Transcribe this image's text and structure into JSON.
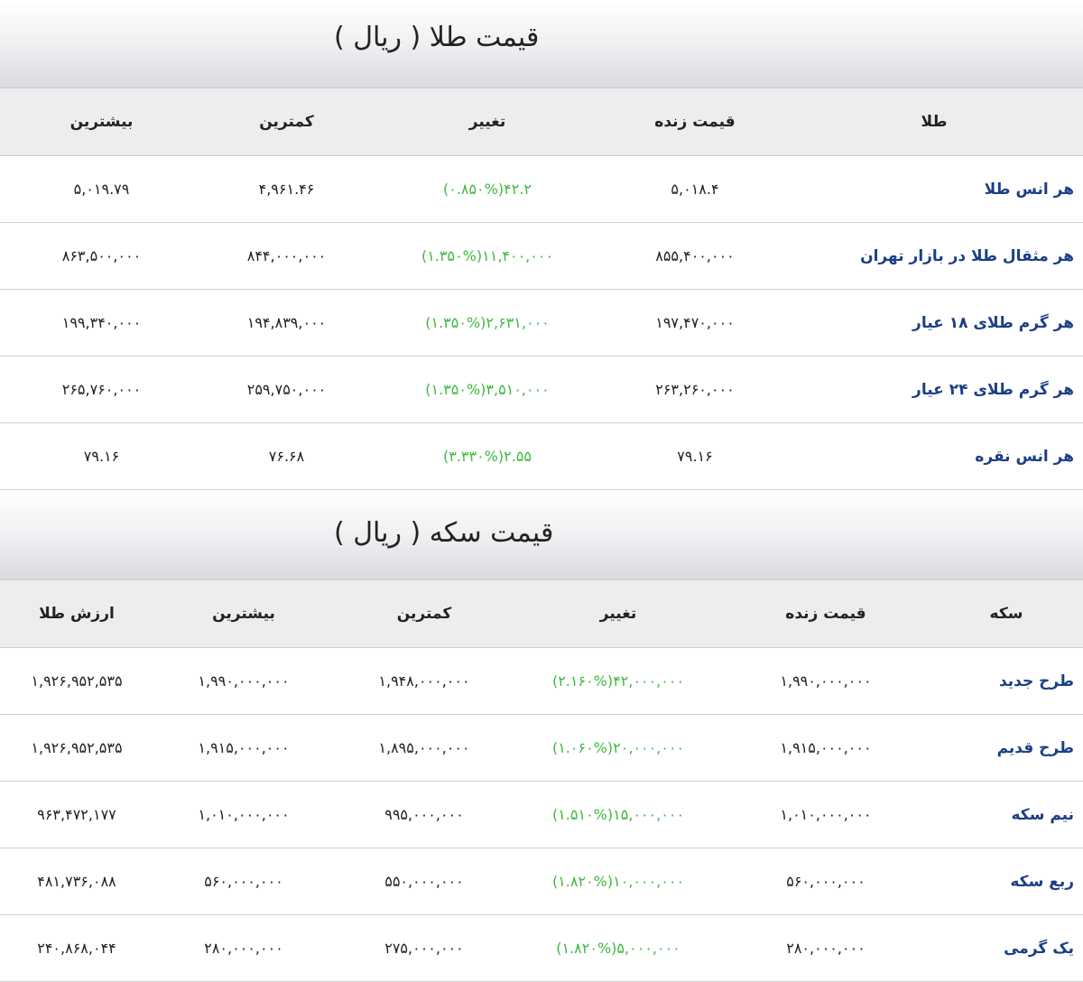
{
  "gold": {
    "title": "قیمت طلا ( ریال )",
    "headers": [
      "طلا",
      "قیمت زنده",
      "تغییر",
      "کمترین",
      "بیشترین"
    ],
    "rows": [
      {
        "name": "هر انس طلا",
        "live": "۵,۰۱۸.۴",
        "change": "۴۲.۲(۰.۸۵۰%)",
        "low": "۴,۹۶۱.۴۶",
        "high": "۵,۰۱۹.۷۹"
      },
      {
        "name": "هر مثقال طلا در بازار تهران",
        "live": "۸۵۵,۴۰۰,۰۰۰",
        "change": "۱۱,۴۰۰,۰۰۰(۱.۳۵۰%)",
        "low": "۸۴۴,۰۰۰,۰۰۰",
        "high": "۸۶۳,۵۰۰,۰۰۰"
      },
      {
        "name": "هر گرم طلای ۱۸ عیار",
        "live": "۱۹۷,۴۷۰,۰۰۰",
        "change": "۲,۶۳۱,۰۰۰(۱.۳۵۰%)",
        "low": "۱۹۴,۸۳۹,۰۰۰",
        "high": "۱۹۹,۳۴۰,۰۰۰"
      },
      {
        "name": "هر گرم طلای ۲۴ عیار",
        "live": "۲۶۳,۲۶۰,۰۰۰",
        "change": "۳,۵۱۰,۰۰۰(۱.۳۵۰%)",
        "low": "۲۵۹,۷۵۰,۰۰۰",
        "high": "۲۶۵,۷۶۰,۰۰۰"
      },
      {
        "name": "هر انس نقره",
        "live": "۷۹.۱۶",
        "change": "۲.۵۵(۳.۳۳۰%)",
        "low": "۷۶.۶۸",
        "high": "۷۹.۱۶"
      }
    ]
  },
  "coin": {
    "title": "قیمت سکه ( ریال )",
    "headers": [
      "سکه",
      "قیمت زنده",
      "تغییر",
      "کمترین",
      "بیشترین",
      "ارزش طلا"
    ],
    "rows": [
      {
        "name": "طرح جدید",
        "live": "۱,۹۹۰,۰۰۰,۰۰۰",
        "change": "۴۲,۰۰۰,۰۰۰(۲.۱۶۰%)",
        "low": "۱,۹۴۸,۰۰۰,۰۰۰",
        "high": "۱,۹۹۰,۰۰۰,۰۰۰",
        "value": "۱,۹۲۶,۹۵۲,۵۳۵"
      },
      {
        "name": "طرح قدیم",
        "live": "۱,۹۱۵,۰۰۰,۰۰۰",
        "change": "۲۰,۰۰۰,۰۰۰(۱.۰۶۰%)",
        "low": "۱,۸۹۵,۰۰۰,۰۰۰",
        "high": "۱,۹۱۵,۰۰۰,۰۰۰",
        "value": "۱,۹۲۶,۹۵۲,۵۳۵"
      },
      {
        "name": "نیم سکه",
        "live": "۱,۰۱۰,۰۰۰,۰۰۰",
        "change": "۱۵,۰۰۰,۰۰۰(۱.۵۱۰%)",
        "low": "۹۹۵,۰۰۰,۰۰۰",
        "high": "۱,۰۱۰,۰۰۰,۰۰۰",
        "value": "۹۶۳,۴۷۲,۱۷۷"
      },
      {
        "name": "ربع سکه",
        "live": "۵۶۰,۰۰۰,۰۰۰",
        "change": "۱۰,۰۰۰,۰۰۰(۱.۸۲۰%)",
        "low": "۵۵۰,۰۰۰,۰۰۰",
        "high": "۵۶۰,۰۰۰,۰۰۰",
        "value": "۴۸۱,۷۳۶,۰۸۸"
      },
      {
        "name": "یک گرمی",
        "live": "۲۸۰,۰۰۰,۰۰۰",
        "change": "۵,۰۰۰,۰۰۰(۱.۸۲۰%)",
        "low": "۲۷۵,۰۰۰,۰۰۰",
        "high": "۲۸۰,۰۰۰,۰۰۰",
        "value": "۲۴۰,۸۶۸,۰۴۴"
      }
    ]
  }
}
